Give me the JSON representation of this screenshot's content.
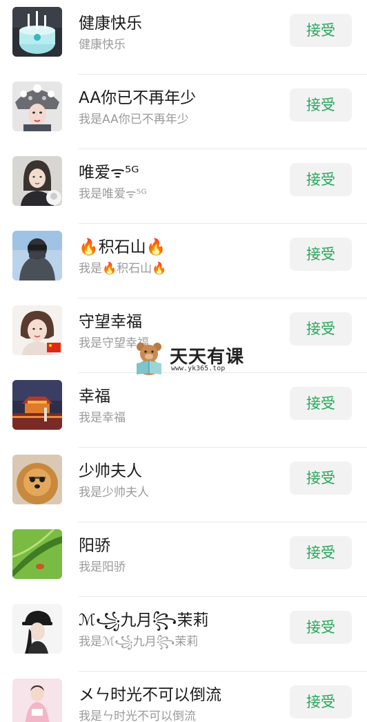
{
  "requests": [
    {
      "name": "健康快乐",
      "message": "健康快乐",
      "accept_label": "接受",
      "avatar": "birthday-cake-avatar"
    },
    {
      "name": "AA你已不再年少",
      "message": "我是AA你已不再年少",
      "accept_label": "接受",
      "avatar": "opera-headdress-avatar"
    },
    {
      "name": "唯爱ᯤ⁵ᴳ",
      "message": "我是唯爱ᯤ⁵ᴳ",
      "accept_label": "接受",
      "avatar": "woman-portrait-avatar"
    },
    {
      "name": "🔥积石山🔥",
      "message": "我是🔥积石山🔥",
      "accept_label": "接受",
      "avatar": "masked-man-avatar"
    },
    {
      "name": "守望幸福",
      "message": "我是守望幸福",
      "accept_label": "接受",
      "avatar": "woman-flag-avatar"
    },
    {
      "name": "幸福",
      "message": "我是幸福",
      "accept_label": "接受",
      "avatar": "night-city-avatar"
    },
    {
      "name": "少帅夫人",
      "message": "我是少帅夫人",
      "accept_label": "接受",
      "avatar": "dog-avatar"
    },
    {
      "name": "阳骄",
      "message": "我是阳骄",
      "accept_label": "接受",
      "avatar": "green-leaf-avatar"
    },
    {
      "name": "ℳ꧁九月꧂茉莉",
      "message": "我是ℳ꧁九月꧂茉莉",
      "accept_label": "接受",
      "avatar": "woman-cap-avatar"
    },
    {
      "name": "メㄣ时光不可以倒流",
      "message": "我是ㄣ时光不可以倒流",
      "accept_label": "接受",
      "avatar": "pink-girl-avatar"
    }
  ],
  "watermark": {
    "title": "天天有课",
    "url": "www.yk365.top"
  }
}
